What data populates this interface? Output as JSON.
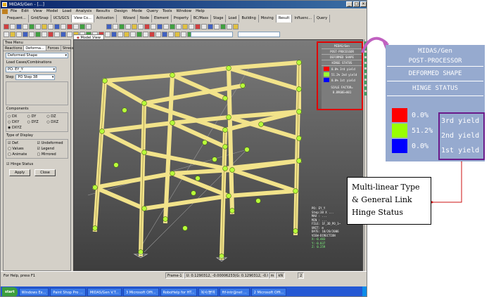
{
  "app": {
    "title": "MIDAS/Gen - [...]",
    "window_buttons": [
      "_",
      "□",
      "×"
    ]
  },
  "menu": [
    "File",
    "Edit",
    "View",
    "Model",
    "Load",
    "Analysis",
    "Results",
    "Design",
    "Mode",
    "Query",
    "Tools",
    "Window",
    "Help"
  ],
  "tabs_left": [
    "Frequent...",
    "Grid/Snap",
    "UCS/GCS",
    "View Co...",
    "Activation"
  ],
  "tabs_right": [
    "Wizard",
    "Node",
    "Element",
    "Property",
    "BC/Mass",
    "Stage",
    "Load",
    "Building",
    "Moving",
    "Result",
    "Influenc...",
    "Query"
  ],
  "active_tab_right": "Result",
  "tree_menu": {
    "title": "Tree Menu",
    "tabs": [
      "Reactions",
      "Deforma...",
      "Forces",
      "Stresses"
    ],
    "active_tab": "Deforma...",
    "shape": "Deformed Shape",
    "load_cases_label": "Load Cases/Combinations",
    "load_case": "PO: EY_Y",
    "step_label": "Step",
    "step": "PO Step 38",
    "components_label": "Components",
    "components": [
      "DX",
      "DY",
      "DZ",
      "DXY",
      "DYZ",
      "DXZ",
      "DXYZ"
    ],
    "selected_component": "DXYZ",
    "display_label": "Type of Display",
    "display_options": [
      "Def.",
      "Undeformed",
      "Values",
      "Legend",
      "Animate",
      "Mirrored"
    ],
    "hinge_status": "Hinge Status",
    "apply": "Apply",
    "close": "Close"
  },
  "model_view_tab": "Model View",
  "legend": {
    "lines": [
      "MIDAS/Gen",
      "POST-PROCESSOR",
      "DEFORMED SHAPE",
      "HINGE STATUS"
    ],
    "rows": [
      {
        "pct": "0.0%",
        "label": "3rd yield",
        "color": "#ff0000"
      },
      {
        "pct": "51.2%",
        "label": "2nd yield",
        "color": "#99ff33"
      },
      {
        "pct": "0.0%",
        "label": "1st yield",
        "color": "#0000ff"
      }
    ],
    "scale_label": "SCALE FACTOR=",
    "scale_value": "8.8960E+001"
  },
  "view_info": [
    "PO: EY_Y",
    "Step:38 X ...",
    "MAX : ...",
    "MIN : ...",
    "FILE: 1F_3D_PO_1~",
    "UNIT: m",
    "DATE: 10/20/2006",
    "VIEW-DIRECTION",
    "X:-0.483",
    "Y:-0.837",
    "Z: 0.259"
  ],
  "status": {
    "help": "For Help, press F1",
    "frame": "Frame-1",
    "coords1": "U: 0.1290312, -0.00006233(G: 0.1290312, -0.00006233",
    "unit": "m",
    "unit2": "kN",
    "tail": "2"
  },
  "taskbar": {
    "start": "start",
    "tasks": [
      "Windows Ex...",
      "Paint Shop Pro ...",
      "MIDAS/Gen V.T...",
      "3 Microsoft Offi...",
      "RoboHelp for HT...",
      "복사/붙여",
      "ftf-intr@net ...",
      "2 Microsoft Offi..."
    ],
    "clock": ""
  },
  "callout": {
    "lines": [
      "MIDAS/Gen",
      "POST-PROCESSOR",
      "DEFORMED SHAPE",
      "HINGE STATUS"
    ],
    "rows": [
      {
        "pct": "0.0%",
        "label": "3rd yield",
        "color": "#ff0000"
      },
      {
        "pct": "51.2%",
        "label": "2nd yield",
        "color": "#99ff00"
      },
      {
        "pct": "0.0%",
        "label": "1st yield",
        "color": "#0000ff"
      }
    ]
  },
  "annotation": {
    "line1": "Multi-linear Type",
    "line2": "& General Link",
    "line3": "Hinge Status"
  },
  "colors": {
    "frame_member": "#f2e38a",
    "hinge": "#b8ff3a",
    "highlight_box": "#e00000",
    "callout_box": "#6a1a8a",
    "arrow": "#c060c0",
    "leader": "#cc1111"
  }
}
